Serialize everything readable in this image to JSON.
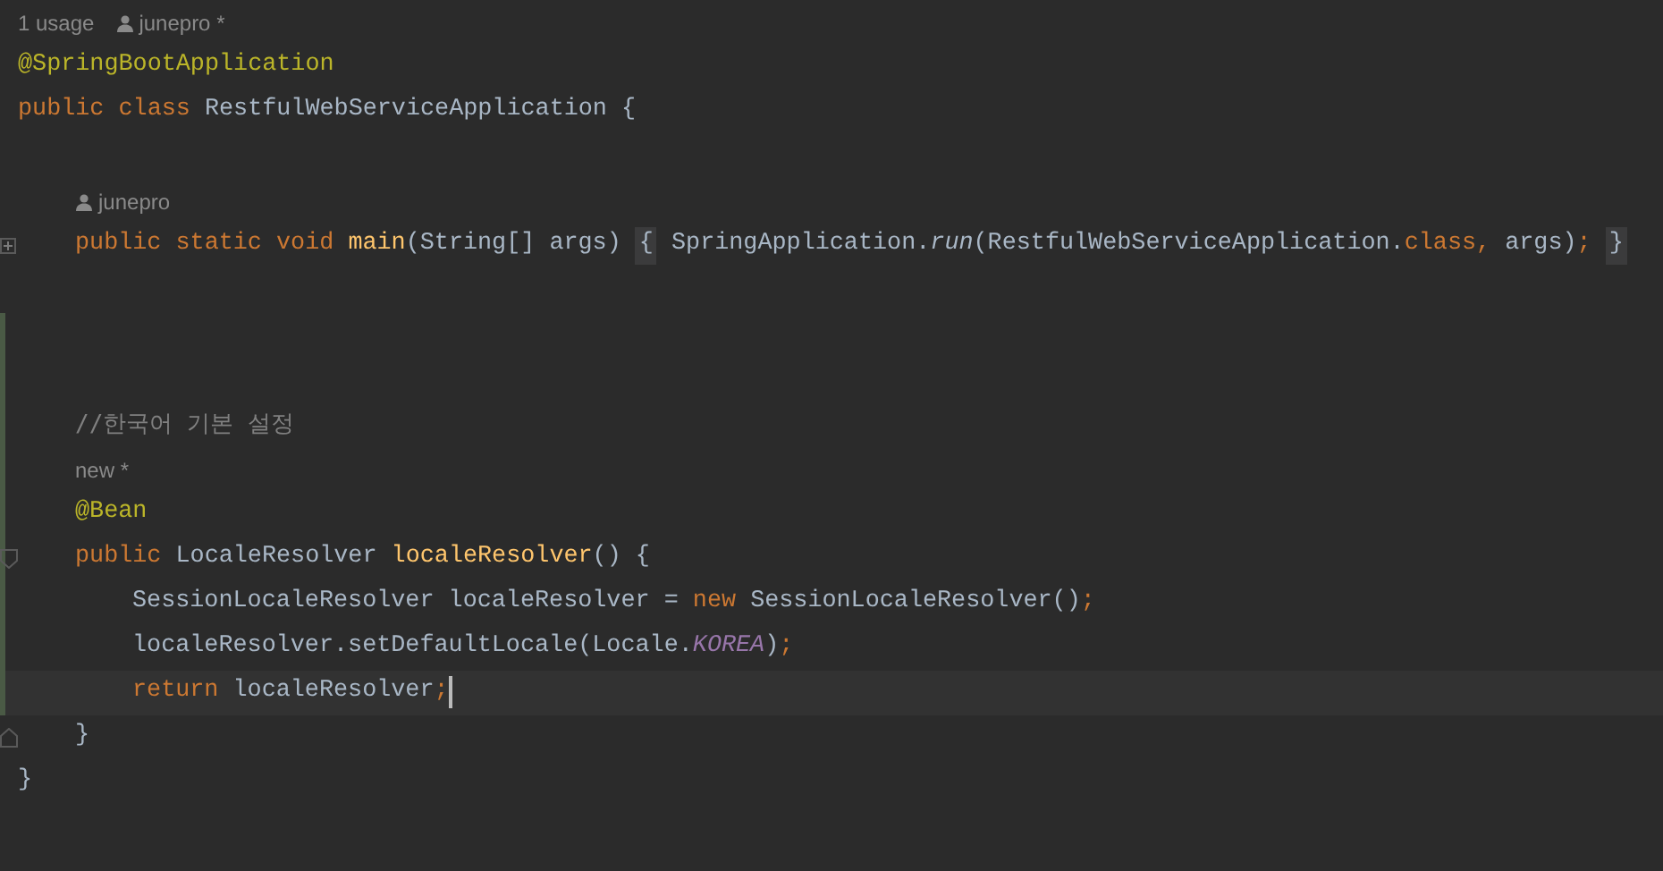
{
  "editor": {
    "lines": [
      {
        "kind": "hint",
        "changed": false,
        "hints": [
          {
            "kind": "text",
            "text": "1 usage"
          },
          {
            "kind": "author",
            "text": "junepro *"
          }
        ]
      },
      {
        "kind": "code",
        "changed": false,
        "caret": false,
        "tokens": [
          {
            "kind": "annotation",
            "text": "@SpringBootApplication"
          }
        ]
      },
      {
        "kind": "code",
        "changed": false,
        "caret": false,
        "tokens": [
          {
            "kind": "keyword",
            "text": "public class "
          },
          {
            "kind": "plain",
            "text": "RestfulWebServiceApplication {"
          }
        ],
        "children": [
          {
            "kind": "blank",
            "changed": false
          },
          {
            "kind": "hint",
            "changed": false,
            "hints": [
              {
                "kind": "author",
                "text": "junepro"
              }
            ]
          },
          {
            "kind": "code",
            "gutter_icon": {
              "kind": "expand"
            },
            "changed": false,
            "caret": false,
            "tokens": [
              {
                "kind": "keyword",
                "text": "public static void "
              },
              {
                "kind": "method",
                "text": "main"
              },
              {
                "kind": "plain",
                "text": "(String[] args) "
              },
              {
                "kind": "folded",
                "text": "{"
              },
              {
                "kind": "plain",
                "text": " SpringApplication."
              },
              {
                "kind": "call",
                "text": "run"
              },
              {
                "kind": "plain",
                "text": "(RestfulWebServiceApplication."
              },
              {
                "kind": "keyword",
                "text": "class, "
              },
              {
                "kind": "plain",
                "text": "args)"
              },
              {
                "kind": "keyword",
                "text": "; "
              },
              {
                "kind": "folded",
                "text": "}"
              }
            ]
          },
          {
            "kind": "blank",
            "changed": false
          },
          {
            "kind": "blank",
            "changed": true
          },
          {
            "kind": "blank",
            "changed": true
          },
          {
            "kind": "code",
            "changed": true,
            "caret": false,
            "tokens": [
              {
                "kind": "comment",
                "text": "//한국어 기본 설정"
              }
            ]
          },
          {
            "kind": "hint",
            "changed": true,
            "hints": [
              {
                "kind": "text",
                "text": "new *"
              }
            ]
          },
          {
            "kind": "code",
            "changed": true,
            "caret": false,
            "tokens": [
              {
                "kind": "annotation",
                "text": "@Bean"
              }
            ]
          },
          {
            "kind": "code",
            "gutter_icon": {
              "kind": "collapse"
            },
            "changed": true,
            "caret": false,
            "tokens": [
              {
                "kind": "keyword",
                "text": "public "
              },
              {
                "kind": "plain",
                "text": "LocaleResolver "
              },
              {
                "kind": "method",
                "text": "localeResolver"
              },
              {
                "kind": "plain",
                "text": "() {"
              }
            ],
            "children": [
              {
                "kind": "code",
                "changed": true,
                "caret": false,
                "tokens": [
                  {
                    "kind": "plain",
                    "text": "SessionLocaleResolver localeResolver = "
                  },
                  {
                    "kind": "keyword",
                    "text": "new "
                  },
                  {
                    "kind": "plain",
                    "text": "SessionLocaleResolver()"
                  },
                  {
                    "kind": "keyword",
                    "text": ";"
                  }
                ]
              },
              {
                "kind": "code",
                "changed": true,
                "caret": false,
                "tokens": [
                  {
                    "kind": "plain",
                    "text": "localeResolver.setDefaultLocale(Locale."
                  },
                  {
                    "kind": "constant",
                    "text": "KOREA"
                  },
                  {
                    "kind": "plain",
                    "text": ")"
                  },
                  {
                    "kind": "keyword",
                    "text": ";"
                  }
                ]
              },
              {
                "kind": "code",
                "changed": true,
                "caret": true,
                "tokens": [
                  {
                    "kind": "keyword",
                    "text": "return "
                  },
                  {
                    "kind": "plain",
                    "text": "localeResolver"
                  },
                  {
                    "kind": "keyword",
                    "text": ";"
                  }
                ]
              }
            ]
          },
          {
            "kind": "code",
            "gutter_icon": {
              "kind": "end"
            },
            "changed": false,
            "caret": false,
            "tokens": [
              {
                "kind": "plain",
                "text": "}"
              }
            ]
          }
        ]
      },
      {
        "kind": "code",
        "changed": false,
        "caret": false,
        "tokens": [
          {
            "kind": "plain",
            "text": "}"
          }
        ]
      }
    ]
  }
}
